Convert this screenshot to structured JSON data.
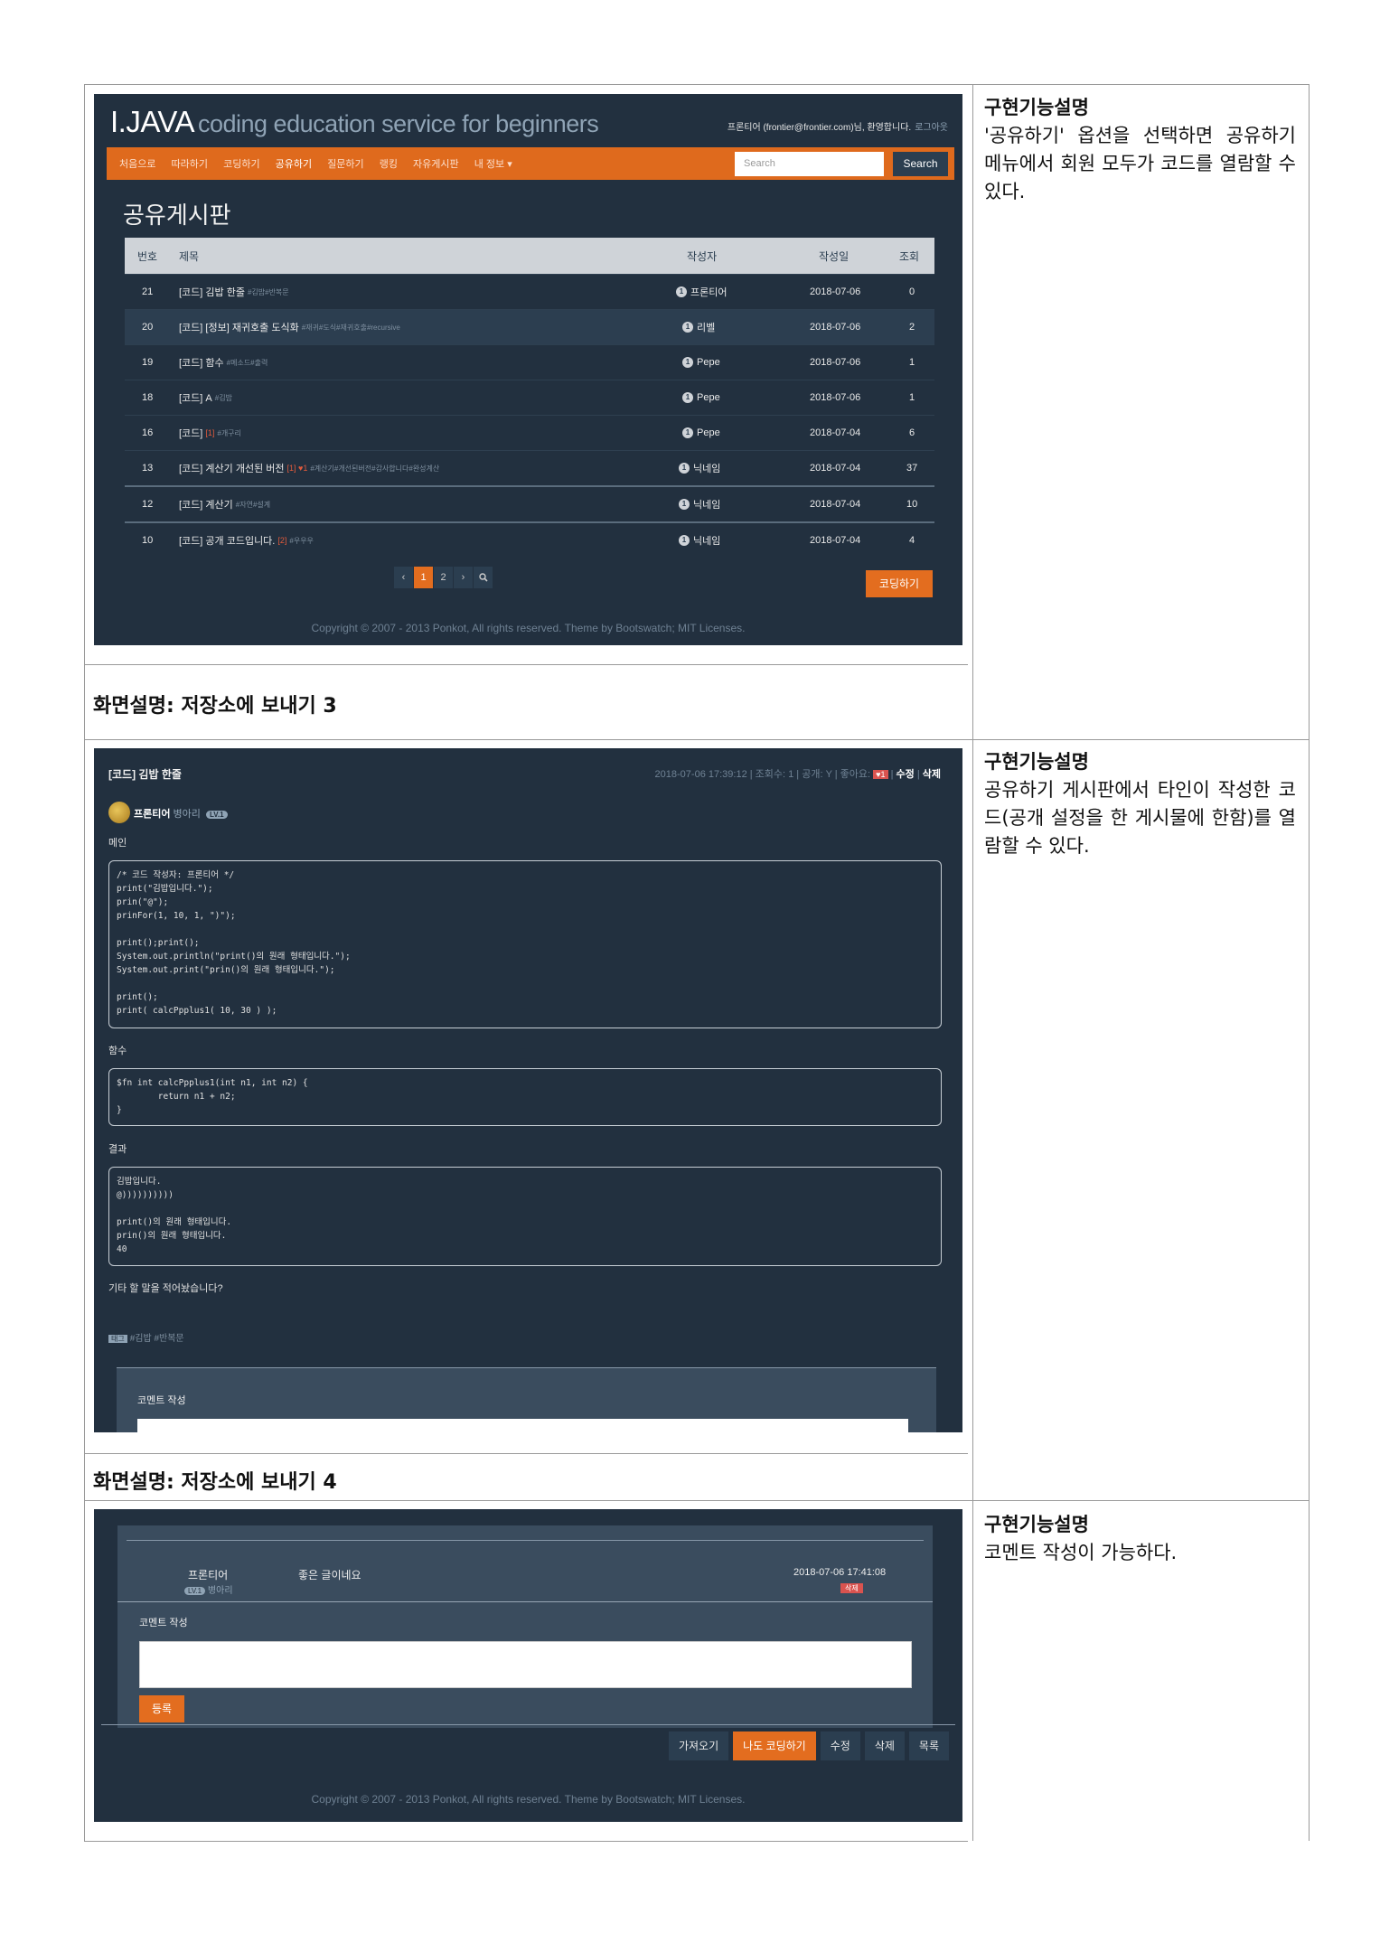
{
  "sections": [
    {
      "desc_title": "구현기능설명",
      "desc_text": "'공유하기' 옵션을 선택하면 공유하기 메뉴에서 회원 모두가 코드를 열람할 수 있다.",
      "caption": "화면설명: 저장소에 보내기 3"
    },
    {
      "desc_title": "구현기능설명",
      "desc_text": "공유하기 게시판에서 타인이 작성한 코드(공개 설정을 한 게시물에 한함)를 열람할 수 있다.",
      "caption": "화면설명: 저장소에 보내기 4"
    },
    {
      "desc_title": "구현기능설명",
      "desc_text": "코멘트 작성이 가능하다."
    }
  ],
  "shot1": {
    "brand": "I.JAVA",
    "brand_sub": "coding education service for beginners",
    "user": "프론티어 (frontier@frontier.com)님, 환영합니다.",
    "logout": "로그아웃",
    "nav": [
      "처음으로",
      "따라하기",
      "코딩하기",
      "공유하기",
      "질문하기",
      "랭킹",
      "자유게시판",
      "내 정보 ▾"
    ],
    "search_placeholder": "Search",
    "search_button": "Search",
    "board_title": "공유게시판",
    "columns": [
      "번호",
      "제목",
      "작성자",
      "작성일",
      "조회"
    ],
    "rows": [
      {
        "no": "21",
        "title": "[코드] 김밥 한줄",
        "tags": "#김밥#반복문",
        "red": "",
        "author": "프론티어",
        "date": "2018-07-06",
        "views": "0"
      },
      {
        "no": "20",
        "title": "[코드] [정보] 재귀호출 도식화",
        "tags": "#재귀#도식#재귀호출#recursive",
        "red": "",
        "author": "리벨",
        "date": "2018-07-06",
        "views": "2"
      },
      {
        "no": "19",
        "title": "[코드] 함수",
        "tags": "#메소드#출력",
        "red": "",
        "author": "Pepe",
        "date": "2018-07-06",
        "views": "1"
      },
      {
        "no": "18",
        "title": "[코드] A",
        "tags": "#김밥",
        "red": "",
        "author": "Pepe",
        "date": "2018-07-06",
        "views": "1"
      },
      {
        "no": "16",
        "title": "[코드]",
        "tags": "#개구리",
        "red": "[1]",
        "author": "Pepe",
        "date": "2018-07-04",
        "views": "6"
      },
      {
        "no": "13",
        "title": "[코드] 계산기 개선된 버전",
        "tags": "#계산기#개선된버전#감사합니다#완성계산",
        "red": "[1] ♥1",
        "author": "닉네임",
        "date": "2018-07-04",
        "views": "37"
      },
      {
        "no": "12",
        "title": "[코드] 계산기",
        "tags": "#자연#설계",
        "red": "",
        "author": "닉네임",
        "date": "2018-07-04",
        "views": "10"
      },
      {
        "no": "10",
        "title": "[코드] 공개 코드입니다.",
        "tags": "#우우우",
        "red": "[2]",
        "author": "닉네임",
        "date": "2018-07-04",
        "views": "4"
      }
    ],
    "pager": [
      "‹",
      "1",
      "2",
      "›",
      "🔍"
    ],
    "code_button": "코딩하기",
    "copyright": "Copyright © 2007 - 2013 Ponkot, All rights reserved. Theme by Bootswatch; MIT Licenses."
  },
  "shot2": {
    "title": "[코드] 김밥 한줄",
    "meta": "2018-07-06 17:39:12 | 조회수: 1 | 공개: Y | 좋아요:",
    "heart": "♥1",
    "edit": "수정",
    "delete": "삭제",
    "author": "프론티어",
    "rank": "병아리",
    "level": "LV.1",
    "label_main": "메인",
    "code_main": "/* 코드 작성자: 프론티어 */\nprint(\"김밥입니다.\");\nprin(\"@\");\nprinFor(1, 10, 1, \")\");\n\nprint();print();\nSystem.out.println(\"print()의 원래 형태입니다.\");\nSystem.out.print(\"prin()의 원래 형태입니다.\");\n\nprint();\nprint( calcPpplus1( 10, 30 ) );",
    "label_func": "함수",
    "code_func": "$fn int calcPpplus1(int n1, int n2) {\n        return n1 + n2;\n}",
    "label_result": "결과",
    "code_result": "김밥입니다.\n@))))))))))\n\nprint()의 원래 형태입니다.\nprin()의 원래 형태입니다.\n40",
    "extra": "기타 할 말을 적어놨습니다?",
    "tag_label": "태그",
    "tags": "#김밥 #반복문",
    "comment_header": "코멘트 작성"
  },
  "shot3": {
    "c_author": "프론티어",
    "c_level": "LV.1",
    "c_rank": "병아리",
    "c_text": "좋은 글이네요",
    "c_date": "2018-07-06 17:41:08",
    "c_delete": "삭제",
    "comment_header": "코멘트 작성",
    "submit": "등록",
    "buttons": [
      "가져오기",
      "나도 코딩하기",
      "수정",
      "삭제",
      "목록"
    ],
    "copyright": "Copyright © 2007 - 2013 Ponkot, All rights reserved. Theme by Bootswatch; MIT Licenses."
  }
}
